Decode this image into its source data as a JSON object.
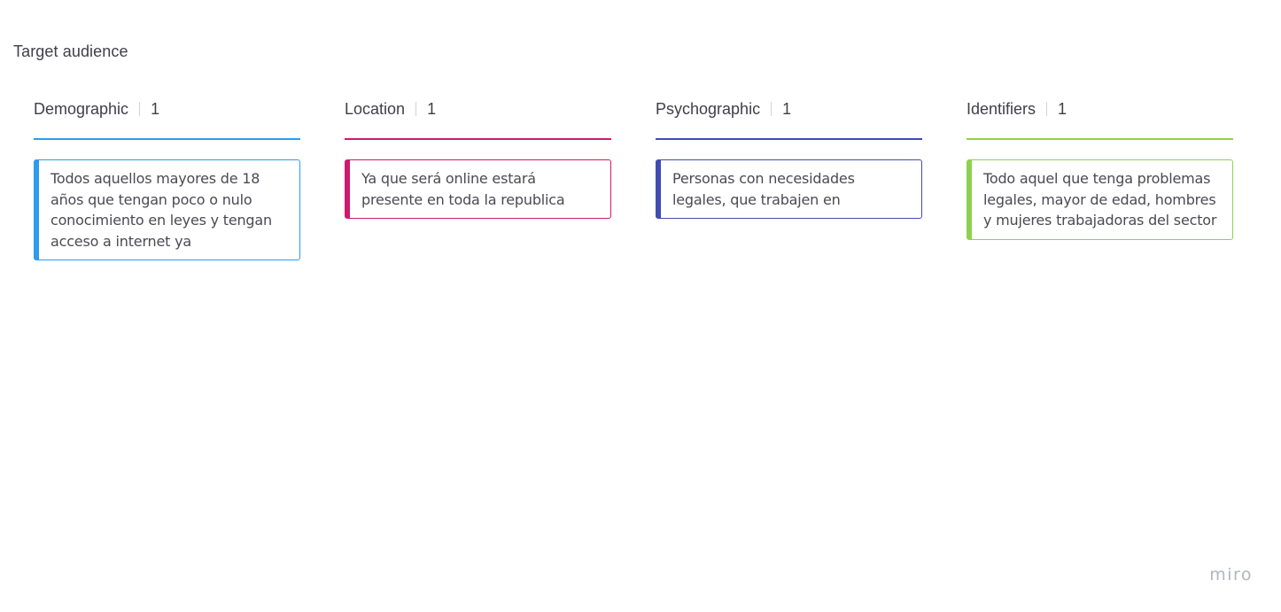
{
  "board": {
    "title": "Target audience"
  },
  "columns": [
    {
      "name": "Demographic",
      "count": "1",
      "color": "#2d9bf0",
      "cards": [
        "Todos aquellos mayores de 18 años que tengan poco o nulo conocimiento en leyes y tengan acceso a internet ya"
      ]
    },
    {
      "name": "Location",
      "count": "1",
      "color": "#cc1a6e",
      "cards": [
        "Ya que será online estará presente en  toda la republica"
      ]
    },
    {
      "name": "Psychographic",
      "count": "1",
      "color": "#414bb2",
      "cards": [
        "Personas con necesidades legales, que trabajen en"
      ]
    },
    {
      "name": "Identifiers",
      "count": "1",
      "color": "#8fd14f",
      "cards": [
        "Todo aquel que tenga problemas legales, mayor de edad, hombres y mujeres trabajadoras del sector"
      ]
    }
  ],
  "branding": {
    "logo_text": "miro"
  }
}
